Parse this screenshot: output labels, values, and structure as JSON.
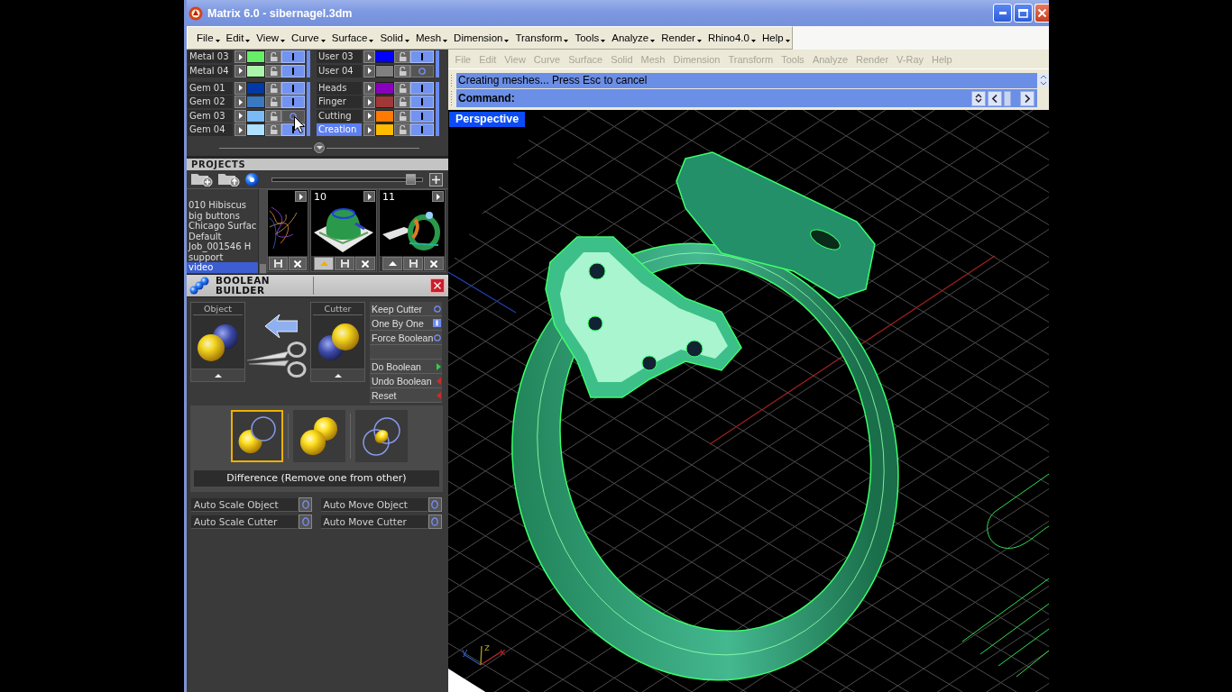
{
  "window": {
    "title": "Matrix 6.0 - sibernagel.3dm"
  },
  "menu": [
    "File",
    "Edit",
    "View",
    "Curve",
    "Surface",
    "Solid",
    "Mesh",
    "Dimension",
    "Transform",
    "Tools",
    "Analyze",
    "Render",
    "Rhino4.0",
    "Help"
  ],
  "layer_panel": {
    "columns": [
      {
        "groups": [
          {
            "layers": [
              {
                "name": "Metal 03",
                "color": "#66ee66",
                "visible": true,
                "selected": false
              },
              {
                "name": "Metal 04",
                "color": "#aaf5aa",
                "visible": true,
                "selected": false
              }
            ]
          },
          {
            "layers": [
              {
                "name": "Gem 01",
                "color": "#0038a8",
                "visible": true,
                "selected": false
              },
              {
                "name": "Gem 02",
                "color": "#3a78c0",
                "visible": true,
                "selected": false
              },
              {
                "name": "Gem 03",
                "color": "#7abaf5",
                "visible": false,
                "selected": false
              },
              {
                "name": "Gem 04",
                "color": "#aee0ff",
                "visible": true,
                "selected": false
              }
            ]
          }
        ]
      },
      {
        "groups": [
          {
            "layers": [
              {
                "name": "User 03",
                "color": "#0000ff",
                "visible": true,
                "selected": false
              },
              {
                "name": "User 04",
                "color": "#808080",
                "visible": false,
                "selected": false
              }
            ]
          },
          {
            "layers": [
              {
                "name": "Heads",
                "color": "#8800bb",
                "visible": true,
                "selected": false
              },
              {
                "name": "Finger",
                "color": "#a03838",
                "visible": true,
                "selected": false
              },
              {
                "name": "Cutting",
                "color": "#ff7a00",
                "visible": true,
                "selected": false
              },
              {
                "name": "Creation",
                "color": "#ffbb00",
                "visible": true,
                "selected": true
              }
            ]
          }
        ]
      }
    ]
  },
  "projects": {
    "title": "PROJECTS",
    "zoom_slider": {
      "level": 0.93
    },
    "list": [
      {
        "name": "010 Hibiscus",
        "selected": false
      },
      {
        "name": "big buttons",
        "selected": false
      },
      {
        "name": "Chicago Surfac",
        "selected": false
      },
      {
        "name": "Default",
        "selected": false
      },
      {
        "name": "Job_001546 H",
        "selected": false
      },
      {
        "name": "support",
        "selected": false
      },
      {
        "name": "video",
        "selected": true
      }
    ],
    "thumbnails": [
      {
        "kind": "wireframe",
        "cropped": true,
        "buttons": [
          {
            "kind": "save"
          },
          {
            "kind": "delete"
          }
        ]
      },
      {
        "number": "10",
        "kind": "dome",
        "cropped": false,
        "buttons": [
          {
            "kind": "raise",
            "active": true
          },
          {
            "kind": "save"
          },
          {
            "kind": "delete"
          }
        ]
      },
      {
        "number": "11",
        "kind": "ring",
        "cropped": false,
        "buttons": [
          {
            "kind": "raise",
            "active": false
          },
          {
            "kind": "save"
          },
          {
            "kind": "delete"
          }
        ]
      }
    ]
  },
  "boolean_builder": {
    "title": "BOOLEAN BUILDER",
    "slots": [
      {
        "label": "Object",
        "kind": "object"
      },
      {
        "label": "Cutter",
        "kind": "cutter"
      }
    ],
    "options": [
      {
        "label": "Keep Cutter",
        "on": false
      },
      {
        "label": "One By One",
        "on": true
      },
      {
        "label": "Force Boolean",
        "on": false
      }
    ],
    "actions": [
      {
        "label": "Do Boolean",
        "kind": "run"
      },
      {
        "label": "Undo Boolean",
        "kind": "back"
      },
      {
        "label": "Reset",
        "kind": "back"
      }
    ],
    "modes": [
      {
        "kind": "difference",
        "selected": true
      },
      {
        "kind": "union",
        "selected": false
      },
      {
        "kind": "intersection",
        "selected": false
      }
    ],
    "mode_caption": "Difference (Remove one from other)",
    "auto_options": [
      {
        "label": "Auto Scale Object",
        "on": false
      },
      {
        "label": "Auto Move Object",
        "on": false
      },
      {
        "label": "Auto Scale Cutter",
        "on": false
      },
      {
        "label": "Auto Move Cutter",
        "on": false
      }
    ]
  },
  "rhino": {
    "menu": [
      {
        "label": "File",
        "disabled": true
      },
      {
        "label": "Edit",
        "disabled": true
      },
      {
        "label": "View",
        "disabled": true
      },
      {
        "label": "Curve",
        "disabled": true
      },
      {
        "label": "Surface",
        "disabled": true
      },
      {
        "label": "Solid",
        "disabled": true
      },
      {
        "label": "Mesh",
        "disabled": true
      },
      {
        "label": "Dimension",
        "disabled": true
      },
      {
        "label": "Transform",
        "disabled": true
      },
      {
        "label": "Tools",
        "disabled": true
      },
      {
        "label": "Analyze",
        "disabled": true
      },
      {
        "label": "Render",
        "disabled": true
      },
      {
        "label": "V-Ray",
        "disabled": true
      },
      {
        "label": "Help",
        "disabled": true
      }
    ],
    "history": "Creating meshes... Press Esc to cancel",
    "prompt": "Command:",
    "viewport": {
      "title": "Perspective",
      "axes": [
        {
          "label": "y",
          "kind": "y"
        },
        {
          "label": "z",
          "kind": "z"
        },
        {
          "label": "x",
          "kind": "x"
        }
      ]
    }
  }
}
